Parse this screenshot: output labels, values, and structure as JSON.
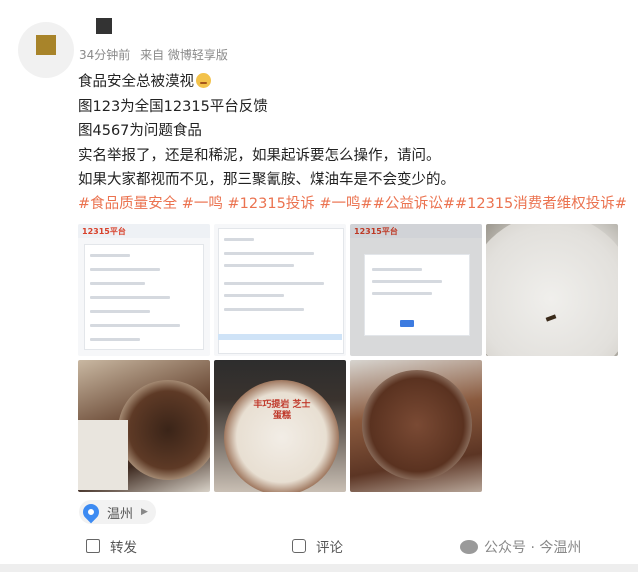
{
  "post": {
    "meta": {
      "time": "34分钟前",
      "source": "来自 微博轻享版"
    },
    "lines": [
      "食品安全总被漠视",
      "图123为全国12315平台反馈",
      "图4567为问题食品",
      "实名举报了，还是和稀泥，如果起诉要怎么操作，请问。",
      "如果大家都视而不见，那三聚氰胺、煤油车是不会变少的。"
    ],
    "tags": "#食品质量安全 #一鸣 #12315投诉 #一鸣##公益诉讼##12315消费者维权投诉#",
    "images": [
      {
        "icon": "screenshot-12315",
        "brand": "12315平台"
      },
      {
        "icon": "screenshot-12315"
      },
      {
        "icon": "screenshot-12315-dialog",
        "brand": "12315平台"
      },
      {
        "icon": "photo-insect-in-lid"
      },
      {
        "icon": "photo-chocolate-cup"
      },
      {
        "icon": "photo-cheesecake-package",
        "label": "丰巧提岩 芝士蛋糕"
      },
      {
        "icon": "photo-lid-residue"
      }
    ],
    "location": "温州",
    "actions": {
      "repost": "转发",
      "comment": "评论"
    },
    "watermark": "公众号 · 今温州"
  }
}
